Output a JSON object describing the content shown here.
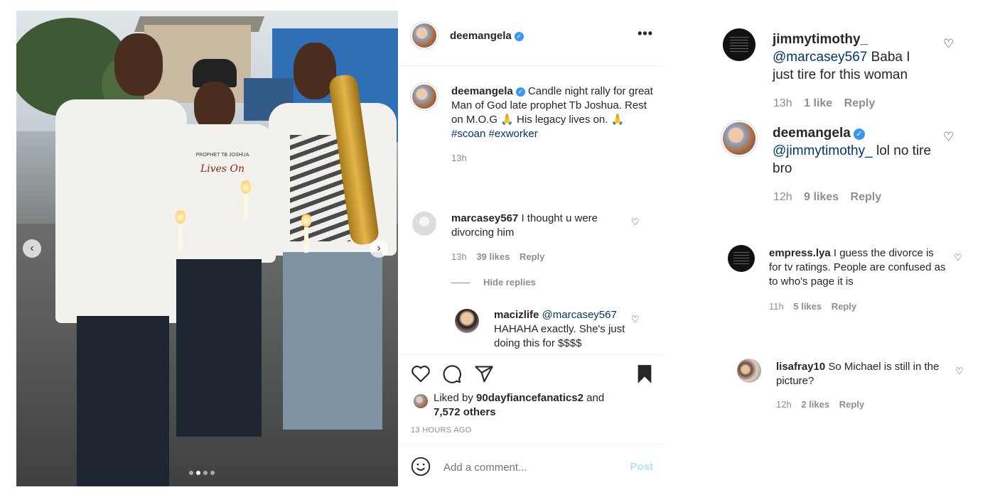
{
  "post": {
    "username": "deemangela",
    "more_label": "•••",
    "caption_text": "Candle night rally for great Man of God late prophet Tb Joshua. Rest on M.O.G 🙏 His legacy lives on. 🙏",
    "hashtags": "#scoan #exworker",
    "caption_time": "13h"
  },
  "photo": {
    "shirt_text_1": "PROPHET TB JOSHUA",
    "shirt_text_2": "Lives On",
    "prev_arrow": "‹",
    "next_arrow": "›"
  },
  "comments": [
    {
      "username": "marcasey567",
      "text": "I thought u were divorcing him",
      "time": "13h",
      "likes": "39 likes",
      "reply_label": "Reply"
    }
  ],
  "hide_replies_label": "Hide replies",
  "replies": [
    {
      "username": "macizlife",
      "mention": "@marcasey567",
      "text": "HAHAHA exactly. She's just doing this for $$$$"
    }
  ],
  "likes_line": {
    "prefix": "Liked by",
    "user": "90dayfiancefanatics2",
    "suffix": "and",
    "others": "7,572 others"
  },
  "timestamp": "13 HOURS AGO",
  "add_comment": {
    "placeholder": "Add a comment...",
    "post_label": "Post"
  },
  "side_comments": [
    {
      "username": "jimmytimothy_",
      "mention": "@marcasey567",
      "text": "Baba I just tire for this woman",
      "time": "13h",
      "likes": "1 like",
      "reply_label": "Reply"
    },
    {
      "username": "deemangela",
      "mention": "@jimmytimothy_",
      "text": "lol no tire bro",
      "time": "12h",
      "likes": "9 likes",
      "reply_label": "Reply"
    },
    {
      "username": "empress.lya",
      "text": "I guess the divorce is for tv ratings. People are confused as to who's page it is",
      "time": "11h",
      "likes": "5 likes",
      "reply_label": "Reply"
    },
    {
      "username": "lisafray10",
      "text": "So Michael is still in the picture?",
      "time": "12h",
      "likes": "2 likes",
      "reply_label": "Reply"
    }
  ],
  "colors": {
    "link": "#00376b",
    "verified": "#3897f0",
    "meta": "#8e8e8e",
    "post_disabled": "#b2dffc"
  }
}
